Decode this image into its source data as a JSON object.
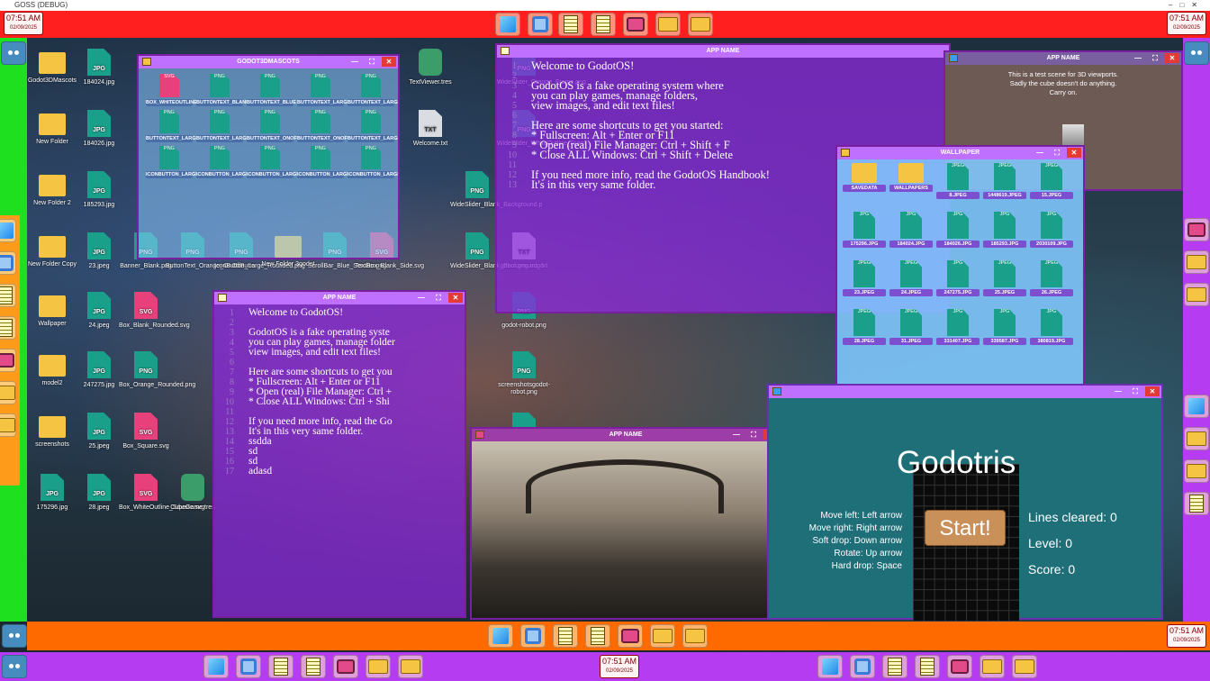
{
  "os_title": "GOSS (DEBUG)",
  "clock": {
    "time": "07:51 AM",
    "date": "02/09/2025"
  },
  "desktop_icons": [
    {
      "name": "Godot3DMascots",
      "type": "folder"
    },
    {
      "name": "New Folder",
      "type": "folder"
    },
    {
      "name": "New Folder 2",
      "type": "folder"
    },
    {
      "name": "New Folder Copy",
      "type": "folder"
    },
    {
      "name": "Wallpaper",
      "type": "folder"
    },
    {
      "name": "model2",
      "type": "folder"
    },
    {
      "name": "screenshots",
      "type": "folder"
    },
    {
      "name": "175296.jpg",
      "type": "jpg"
    },
    {
      "name": "184024.jpg",
      "type": "jpg"
    },
    {
      "name": "184026.jpg",
      "type": "jpg"
    },
    {
      "name": "185293.jpg",
      "type": "jpg"
    },
    {
      "name": "23.jpeg",
      "type": "jpg"
    },
    {
      "name": "24.jpeg",
      "type": "jpg"
    },
    {
      "name": "247275.jpg",
      "type": "jpg"
    },
    {
      "name": "25.jpeg",
      "type": "jpg"
    },
    {
      "name": "28.jpeg",
      "type": "jpg"
    },
    {
      "name": "Banner_Blank.png",
      "type": "png"
    },
    {
      "name": "Box_Blank_Rounded.svg",
      "type": "svg"
    },
    {
      "name": "Box_Orange_Rounded.png",
      "type": "png"
    },
    {
      "name": "Box_Square.svg",
      "type": "svg"
    },
    {
      "name": "Box_WhiteOutline_Square.svg",
      "type": "svg"
    },
    {
      "name": "ButtonText_Orange_OnOffButto",
      "type": "png"
    },
    {
      "name": "IconButton_Large_Roufided.png",
      "type": "png"
    },
    {
      "name": "New Folder 3godot",
      "type": "folder"
    },
    {
      "name": "ScrollBar_Blue_Scroller.png",
      "type": "png"
    },
    {
      "name": "TextBox_Blank_Side.svg",
      "type": "svg"
    },
    {
      "name": "TextViewer.tres",
      "type": "gd"
    },
    {
      "name": "Welcome.txt",
      "type": "txt"
    },
    {
      "name": "WideSlider_Blank_Background.p",
      "type": "png"
    },
    {
      "name": "WideSlider_Blank_Background_1",
      "type": "png"
    },
    {
      "name": "WideSlider_Orange_Frame.png",
      "type": "png"
    },
    {
      "name": "WideSlider_WhiteOutline_Fram",
      "type": "png"
    },
    {
      "name": "gdbot.png.import",
      "type": "txt"
    },
    {
      "name": "godot-robot.png",
      "type": "png"
    },
    {
      "name": "screenshotsgodot-robot.png",
      "type": "png"
    },
    {
      "name": "sophia.png",
      "type": "png"
    },
    {
      "name": "project_preview.png.import",
      "type": "txt"
    },
    {
      "name": "CubeGame.tres",
      "type": "gd"
    }
  ],
  "windows": {
    "mascots": {
      "title": "GODOT3DMASCOTS",
      "labels": [
        "BOX_WHITEOUTLINE_ROUNDED",
        "BUTTONTEXT_BLANK_ONOFF",
        "BUTTONTEXT_BLUE_ONOFF",
        "BUTTONTEXT_LARGE_BLANK",
        "BUTTONTEXT_LARGE_BLUE",
        "BUTTONTEXT_LARGE_GREYOUT",
        "BUTTONTEXT_LARGE_SQUARE",
        "BUTTONTEXT_ONOFFBACKGROUND",
        "BUTTONTEXT_ONOFFBUTTON",
        "BUTTONTEXT_LARGE_TEXTFIELD",
        "ICONBUTTON_LARGE_BLANK",
        "ICONBUTTON_LARGE_GREEN",
        "ICONBUTTON_LARGE_GREEN_SQ",
        "ICONBUTTON_LARGE_GREYOUT",
        "ICONBUTTON_LARGE_GREYOUT2"
      ]
    },
    "welcome_big": {
      "title": "APP NAME",
      "lines": [
        "Welcome to GodotOS!",
        "",
        "GodotOS is a fake operating system where",
        "you can play games, manage folders,",
        "view images, and edit text files!",
        "",
        "Here are some shortcuts to get you started:",
        "*    Fullscreen: Alt + Enter or F11",
        "*    Open (real) File Manager: Ctrl + Shift + F",
        "*    Close ALL Windows: Ctrl + Shift + Delete",
        "",
        "If you need more info, read the GodotOS Handbook!",
        "It's in this very same folder."
      ]
    },
    "welcome_small": {
      "title": "APP NAME",
      "lines": [
        "Welcome to GodotOS!",
        "",
        "GodotOS is a fake operating syste",
        "you can play games, manage folder",
        "view images, and edit text files!",
        "",
        "Here are some shortcuts to get you",
        "*    Fullscreen: Alt + Enter or F11",
        "*    Open (real) File Manager: Ctrl +",
        "*    Close ALL Windows: Ctrl + Shi",
        "",
        "If you need more info, read the Go",
        "It's in this very same folder.",
        "ssdda",
        "sd",
        "sd",
        "adasd"
      ]
    },
    "cube": {
      "title": "APP NAME",
      "lines": [
        "This is a test scene for 3D viewports.",
        "Sadly the cube doesn't do anything.",
        "Carry on."
      ]
    },
    "wallpaper": {
      "title": "WALLPAPER",
      "items": [
        {
          "label": "SAVEDATA",
          "type": "folder"
        },
        {
          "label": "WALLPAPERS",
          "type": "folder"
        },
        {
          "label": "8.JPEG",
          "type": "jpeg"
        },
        {
          "label": "1448619.JPEG",
          "type": "jpeg"
        },
        {
          "label": "15.JPEG",
          "type": "jpeg"
        },
        {
          "label": "175296.JPG",
          "type": "jpg"
        },
        {
          "label": "184024.JPG",
          "type": "jpg"
        },
        {
          "label": "184026.JPG",
          "type": "jpg"
        },
        {
          "label": "185293.JPG",
          "type": "jpg"
        },
        {
          "label": "2030109.JPG",
          "type": "jpg"
        },
        {
          "label": "23.JPEG",
          "type": "jpeg"
        },
        {
          "label": "24.JPEG",
          "type": "jpeg"
        },
        {
          "label": "247275.JPG",
          "type": "jpg"
        },
        {
          "label": "25.JPEG",
          "type": "jpeg"
        },
        {
          "label": "26.JPEG",
          "type": "jpeg"
        },
        {
          "label": "28.JPEG",
          "type": "jpeg"
        },
        {
          "label": "31.JPEG",
          "type": "jpeg"
        },
        {
          "label": "331407.JPG",
          "type": "jpg"
        },
        {
          "label": "339587.JPG",
          "type": "jpg"
        },
        {
          "label": "380819.JPG",
          "type": "jpg"
        }
      ]
    },
    "image_viewer": {
      "title": "APP NAME"
    },
    "godotris": {
      "title": "Godotris",
      "start": "Start!",
      "controls": [
        "Move left: Left arrow",
        "Move right: Right arrow",
        "Soft drop: Down arrow",
        "Rotate: Up arrow",
        "Hard drop: Space"
      ],
      "lines_cleared": "Lines cleared: 0",
      "level": "Level: 0",
      "score": "Score: 0"
    }
  },
  "colors": {
    "top_panel": "#ff1f1f",
    "bottom_panel_1": "#ff6a00",
    "bottom_panel_2": "#b53cf0",
    "left_panel": "#1ee01e",
    "right_panel": "#b53cf0"
  }
}
